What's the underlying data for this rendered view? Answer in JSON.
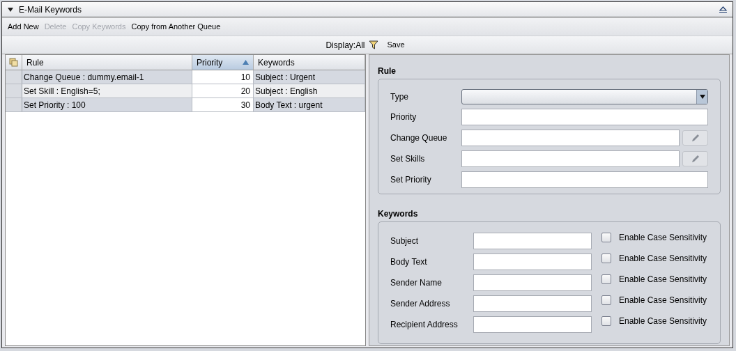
{
  "panel": {
    "title": "E-Mail Keywords"
  },
  "toolbar": [
    {
      "label": "Add New",
      "disabled": false
    },
    {
      "label": "Delete",
      "disabled": true
    },
    {
      "label": "Copy Keywords",
      "disabled": true
    },
    {
      "label": "Copy from Another Queue",
      "disabled": false
    }
  ],
  "filter_bar": {
    "display": "Display:All",
    "save": "Save"
  },
  "table": {
    "columns": [
      {
        "label": "Rule",
        "sorted": false
      },
      {
        "label": "Priority",
        "sorted": true
      },
      {
        "label": "Keywords",
        "sorted": false
      }
    ],
    "rows": [
      {
        "rule": "Change Queue : dummy.email-1",
        "priority": "10",
        "keywords": "Subject : Urgent"
      },
      {
        "rule": "Set Skill : English=5;",
        "priority": "20",
        "keywords": "Subject : English"
      },
      {
        "rule": "Set Priority : 100",
        "priority": "30",
        "keywords": "Body Text : urgent"
      }
    ]
  },
  "rule_section": {
    "title": "Rule",
    "fields": [
      {
        "label": "Type",
        "kind": "dropdown"
      },
      {
        "label": "Priority",
        "kind": "text"
      },
      {
        "label": "Change Queue",
        "kind": "edit"
      },
      {
        "label": "Set Skills",
        "kind": "edit"
      },
      {
        "label": "Set Priority",
        "kind": "text"
      }
    ]
  },
  "keywords_section": {
    "title": "Keywords",
    "fields": [
      {
        "label": "Subject",
        "checkbox": "Enable Case Sensitivity",
        "checked": false
      },
      {
        "label": "Body Text",
        "checkbox": "Enable Case Sensitivity",
        "checked": false
      },
      {
        "label": "Sender Name",
        "checkbox": "Enable Case Sensitivity",
        "checked": false
      },
      {
        "label": "Sender Address",
        "checkbox": "Enable Case Sensitivity",
        "checked": false
      },
      {
        "label": "Recipient Address",
        "checkbox": "Enable Case Sensitivity",
        "checked": false
      }
    ]
  }
}
